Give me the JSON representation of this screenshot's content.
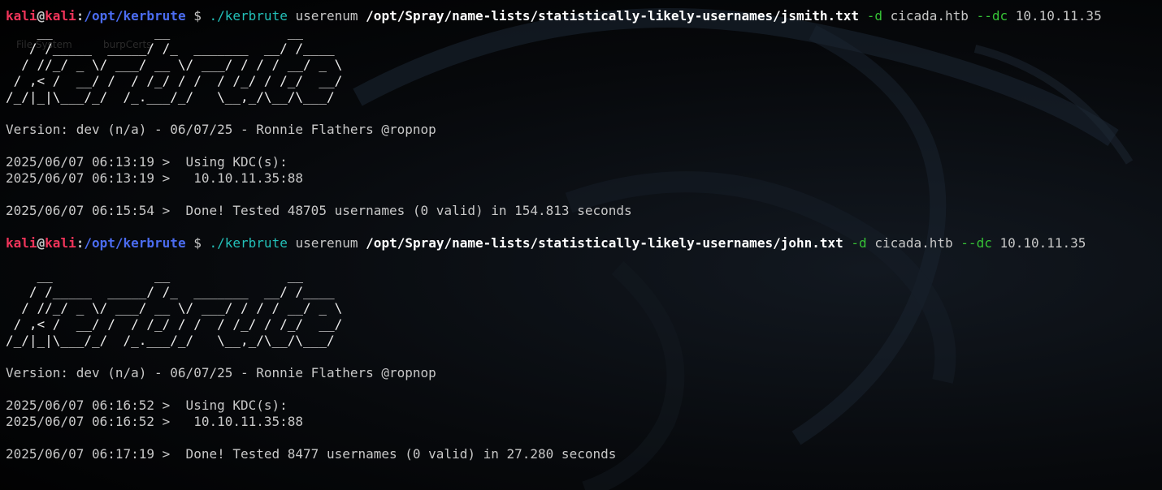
{
  "theme": {
    "background": "#000000",
    "text": "#c8c8c8",
    "user_color": "#f0345a",
    "path_color": "#4b6cf0",
    "command_color": "#23c0b8",
    "flag_color": "#36c236",
    "bold_white": "#ffffff"
  },
  "desktop_labels": [
    "File System",
    "burpCerts"
  ],
  "prompt": {
    "user": "kali",
    "at": "@",
    "host": "kali",
    "colon": ":",
    "cwd": "/opt/kerbrute",
    "symbol": "$"
  },
  "commands": [
    {
      "command": "./kerbrute",
      "subcommand": "userenum",
      "wordlist": "/opt/Spray/name-lists/statistically-likely-usernames/jsmith.txt",
      "domain_flag": "-d",
      "domain": "cicada.htb",
      "dc_flag": "--dc",
      "dc": "10.10.11.35"
    },
    {
      "command": "./kerbrute",
      "subcommand": "userenum",
      "wordlist": "/opt/Spray/name-lists/statistically-likely-usernames/john.txt",
      "domain_flag": "-d",
      "domain": "cicada.htb",
      "dc_flag": "--dc",
      "dc": "10.10.11.35"
    }
  ],
  "banner": [
    "    __             __               __     ",
    "   / /_____  _____/ /_  _______  __/ /____ ",
    "  / //_/ _ \\/ ___/ __ \\/ ___/ / / / __/ _ \\",
    " / ,< /  __/ /  / /_/ / /  / /_/ / /_/  __/",
    "/_/|_|\\___/_/  /_.___/_/   \\__,_/\\__/\\___/ "
  ],
  "runs": [
    {
      "version": "Version: dev (n/a) - 06/07/25 - Ronnie Flathers @ropnop",
      "kdc_line": "2025/06/07 06:13:19 >  Using KDC(s):",
      "kdc_addr": "2025/06/07 06:13:19 >   10.10.11.35:88",
      "result": "2025/06/07 06:15:54 >  Done! Tested 48705 usernames (0 valid) in 154.813 seconds"
    },
    {
      "version": "Version: dev (n/a) - 06/07/25 - Ronnie Flathers @ropnop",
      "kdc_line": "2025/06/07 06:16:52 >  Using KDC(s):",
      "kdc_addr": "2025/06/07 06:16:52 >   10.10.11.35:88",
      "result": "2025/06/07 06:17:19 >  Done! Tested 8477 usernames (0 valid) in 27.280 seconds"
    }
  ]
}
